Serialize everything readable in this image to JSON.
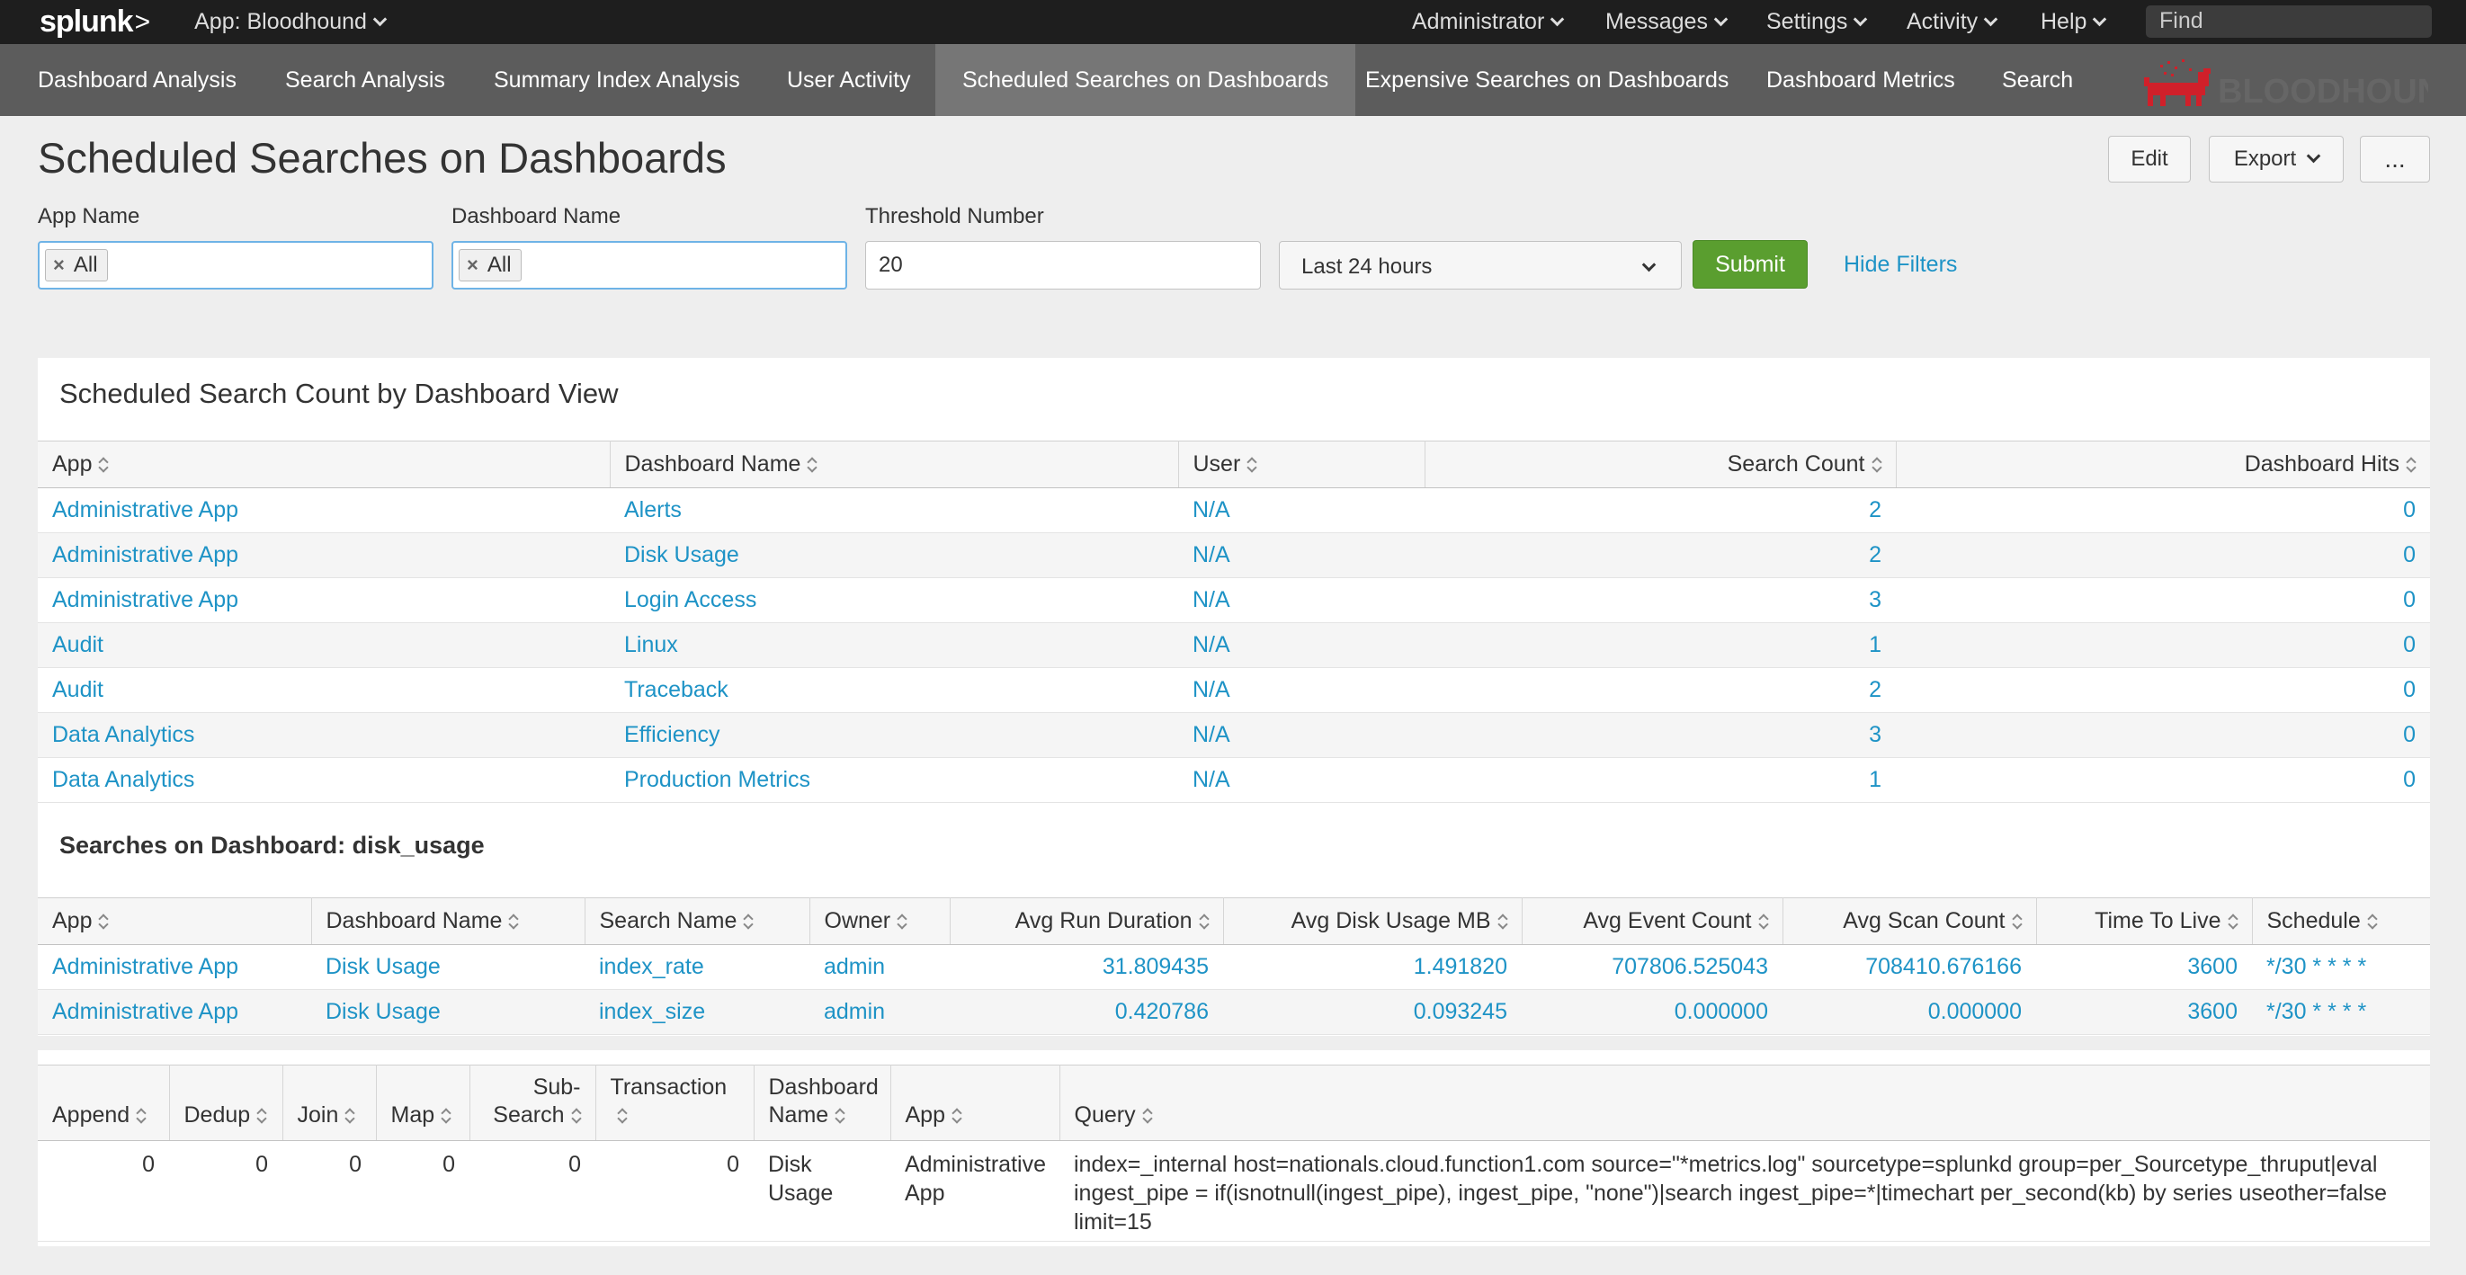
{
  "topbar": {
    "logo": "splunk",
    "logo_suffix": ">",
    "app_label": "App: Bloodhound",
    "menus": [
      "Administrator",
      "Messages",
      "Settings",
      "Activity",
      "Help"
    ],
    "find_placeholder": "Find"
  },
  "nav": {
    "items": [
      "Dashboard Analysis",
      "Search Analysis",
      "Summary Index Analysis",
      "User Activity",
      "Scheduled Searches on Dashboards",
      "Expensive Searches on Dashboards",
      "Dashboard Metrics",
      "Search"
    ],
    "active": "Scheduled Searches on Dashboards",
    "brand": "BLOODHOUND"
  },
  "page": {
    "title": "Scheduled Searches on Dashboards",
    "edit_label": "Edit",
    "export_label": "Export",
    "more_label": "..."
  },
  "filters": {
    "app_name_label": "App Name",
    "app_name_token": "All",
    "dashboard_name_label": "Dashboard Name",
    "dashboard_name_token": "All",
    "threshold_label": "Threshold Number",
    "threshold_value": "20",
    "time_range": "Last 24 hours",
    "submit_label": "Submit",
    "hide_filters_label": "Hide Filters"
  },
  "panel1": {
    "title": "Scheduled Search Count by Dashboard View",
    "columns": [
      "App",
      "Dashboard Name",
      "User",
      "Search Count",
      "Dashboard Hits"
    ],
    "rows": [
      [
        "Administrative App",
        "Alerts",
        "N/A",
        "2",
        "0"
      ],
      [
        "Administrative App",
        "Disk Usage",
        "N/A",
        "2",
        "0"
      ],
      [
        "Administrative App",
        "Login Access",
        "N/A",
        "3",
        "0"
      ],
      [
        "Audit",
        "Linux",
        "N/A",
        "1",
        "0"
      ],
      [
        "Audit",
        "Traceback",
        "N/A",
        "2",
        "0"
      ],
      [
        "Data Analytics",
        "Efficiency",
        "N/A",
        "3",
        "0"
      ],
      [
        "Data Analytics",
        "Production Metrics",
        "N/A",
        "1",
        "0"
      ]
    ]
  },
  "panel2": {
    "title": "Searches on Dashboard: disk_usage",
    "columns": [
      "App",
      "Dashboard Name",
      "Search Name",
      "Owner",
      "Avg Run Duration",
      "Avg Disk Usage MB",
      "Avg Event Count",
      "Avg Scan Count",
      "Time To Live",
      "Schedule"
    ],
    "rows": [
      [
        "Administrative App",
        "Disk Usage",
        "index_rate",
        "admin",
        "31.809435",
        "1.491820",
        "707806.525043",
        "708410.676166",
        "3600",
        "*/30 * * * *"
      ],
      [
        "Administrative App",
        "Disk Usage",
        "index_size",
        "admin",
        "0.420786",
        "0.093245",
        "0.000000",
        "0.000000",
        "3600",
        "*/30 * * * *"
      ]
    ]
  },
  "panel3": {
    "columns": [
      "Append",
      "Dedup",
      "Join",
      "Map",
      "Sub-Search",
      "Transaction",
      "Dashboard Name",
      "App",
      "Query"
    ],
    "rows": [
      [
        "0",
        "0",
        "0",
        "0",
        "0",
        "0",
        "Disk Usage",
        "Administrative App",
        "index=_internal host=nationals.cloud.function1.com source=\"*metrics.log\" sourcetype=splunkd group=per_Sourcetype_thruput|eval ingest_pipe = if(isnotnull(ingest_pipe), ingest_pipe, \"none\")|search ingest_pipe=*|timechart per_second(kb) by series useother=false limit=15"
      ]
    ]
  }
}
